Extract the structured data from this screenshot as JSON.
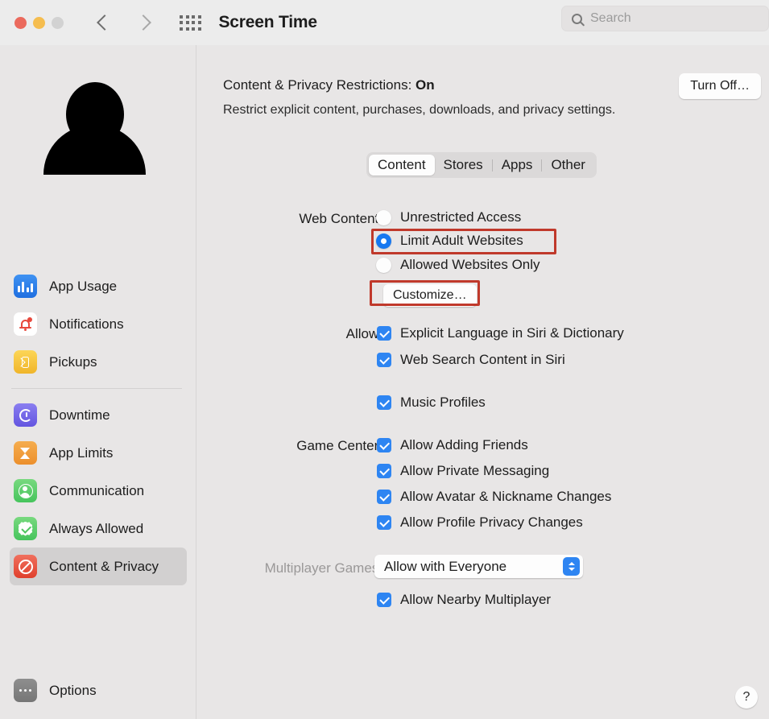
{
  "titlebar": {
    "app_title": "Screen Time",
    "search_placeholder": "Search",
    "icons": {
      "back": "chevron-left-icon",
      "forward": "chevron-right-icon",
      "grid": "show-all-icon",
      "search": "search-icon"
    }
  },
  "sidebar": {
    "avatar": "user-avatar",
    "group1": [
      {
        "label": "App Usage",
        "icon": "app-usage-icon",
        "color": "#2f80e8",
        "selected": false
      },
      {
        "label": "Notifications",
        "icon": "notifications-bell-icon",
        "color": "#ffffff",
        "selected": false
      },
      {
        "label": "Pickups",
        "icon": "pickups-icon",
        "color": "#f4c232",
        "selected": false
      }
    ],
    "group2": [
      {
        "label": "Downtime",
        "icon": "downtime-icon",
        "color": "#6f62e6",
        "selected": false
      },
      {
        "label": "App Limits",
        "icon": "app-limits-hourglass-icon",
        "color": "#f09a36",
        "selected": false
      },
      {
        "label": "Communication",
        "icon": "communication-icon",
        "color": "#55c968",
        "selected": false
      },
      {
        "label": "Always Allowed",
        "icon": "always-allowed-icon",
        "color": "#55c968",
        "selected": false
      },
      {
        "label": "Content & Privacy",
        "icon": "content-privacy-icon",
        "color": "#e24b34",
        "selected": true
      }
    ],
    "options": {
      "label": "Options",
      "icon": "options-ellipsis-icon",
      "color": "#7f7f7f"
    }
  },
  "main": {
    "header_prefix": "Content & Privacy Restrictions: ",
    "header_status": "On",
    "header_subtitle": "Restrict explicit content, purchases, downloads, and privacy settings.",
    "turn_off_label": "Turn Off…",
    "tabs": [
      {
        "label": "Content",
        "active": true
      },
      {
        "label": "Stores",
        "active": false
      },
      {
        "label": "Apps",
        "active": false
      },
      {
        "label": "Other",
        "active": false
      }
    ],
    "web_content": {
      "label": "Web Content:",
      "options": [
        {
          "label": "Unrestricted Access",
          "selected": false
        },
        {
          "label": "Limit Adult Websites",
          "selected": true
        },
        {
          "label": "Allowed Websites Only",
          "selected": false
        }
      ],
      "customize_label": "Customize…"
    },
    "allow": {
      "label": "Allow:",
      "items": [
        {
          "label": "Explicit Language in Siri & Dictionary",
          "checked": true
        },
        {
          "label": "Web Search Content in Siri",
          "checked": true
        },
        {
          "label": "Music Profiles",
          "checked": true
        }
      ]
    },
    "game_center": {
      "label": "Game Center:",
      "items": [
        {
          "label": "Allow Adding Friends",
          "checked": true
        },
        {
          "label": "Allow Private Messaging",
          "checked": true
        },
        {
          "label": "Allow Avatar & Nickname Changes",
          "checked": true
        },
        {
          "label": "Allow Profile Privacy Changes",
          "checked": true
        }
      ]
    },
    "multiplayer": {
      "label": "Multiplayer Games:",
      "value": "Allow with Everyone",
      "nearby": {
        "label": "Allow Nearby Multiplayer",
        "checked": true
      }
    },
    "help_label": "?",
    "highlight_color": "#c0392b"
  }
}
